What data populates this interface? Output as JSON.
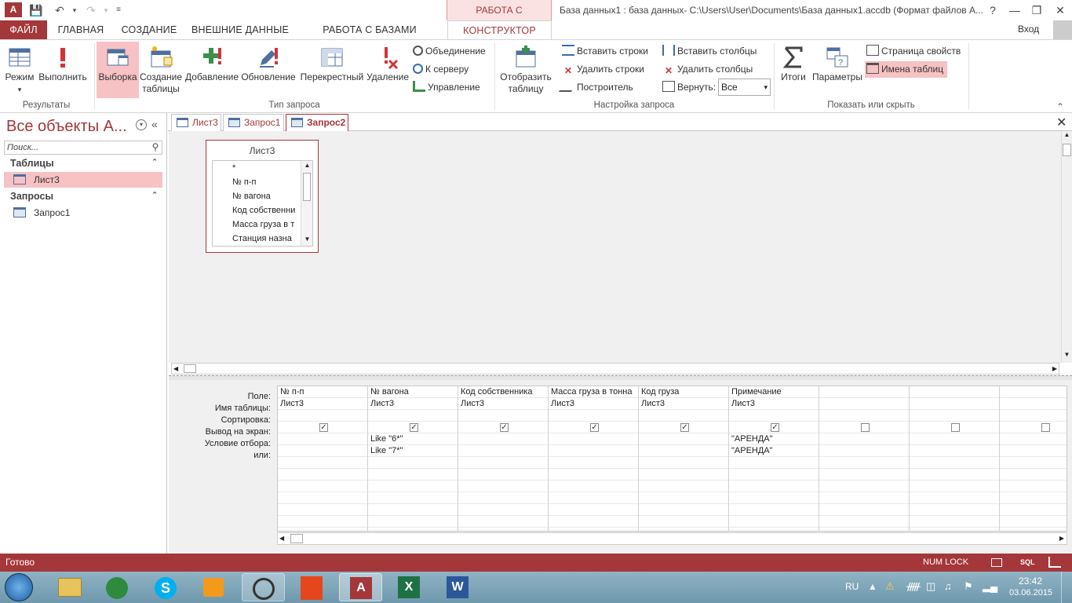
{
  "window": {
    "app_icon": "A",
    "contextual_group": "РАБОТА С ЗАПРОСАМИ",
    "title": "База данных1 : база данных- C:\\Users\\User\\Documents\\База данных1.accdb (Формат файлов A...",
    "help": "?",
    "login": "Вход"
  },
  "tabs": [
    "ФАЙЛ",
    "ГЛАВНАЯ",
    "СОЗДАНИЕ",
    "ВНЕШНИЕ ДАННЫЕ",
    "РАБОТА С БАЗАМИ ДАННЫХ",
    "КОНСТРУКТОР"
  ],
  "ribbon": {
    "results": {
      "mode": "Режим",
      "run": "Выполнить",
      "group": "Результаты"
    },
    "query_type": {
      "select": "Выборка",
      "make_table_1": "Создание",
      "make_table_2": "таблицы",
      "append": "Добавление",
      "update": "Обновление",
      "crosstab": "Перекрестный",
      "delete": "Удаление",
      "union": "Объединение",
      "passthrough": "К серверу",
      "ddl": "Управление",
      "group": "Тип запроса"
    },
    "setup": {
      "show_table_1": "Отобразить",
      "show_table_2": "таблицу",
      "insert_rows": "Вставить строки",
      "delete_rows": "Удалить строки",
      "builder": "Построитель",
      "insert_cols": "Вставить столбцы",
      "delete_cols": "Удалить столбцы",
      "return": "Вернуть:",
      "return_value": "Все",
      "group": "Настройка запроса"
    },
    "show_hide": {
      "totals": "Итоги",
      "params": "Параметры",
      "property_sheet": "Страница свойств",
      "table_names": "Имена таблиц",
      "group": "Показать или скрыть"
    }
  },
  "nav": {
    "title": "Все объекты А...",
    "search": "Поиск...",
    "tables_header": "Таблицы",
    "tables": [
      "Лист3"
    ],
    "queries_header": "Запросы",
    "queries": [
      "Запрос1"
    ]
  },
  "doc_tabs": [
    "Лист3",
    "Запрос1",
    "Запрос2"
  ],
  "table_box": {
    "title": "Лист3",
    "fields": [
      "*",
      "№ п-п",
      "№ вагона",
      "Код собственни",
      "Масса груза в т",
      "Станция назна"
    ]
  },
  "grid": {
    "row_labels": [
      "Поле:",
      "Имя таблицы:",
      "Сортировка:",
      "Вывод на экран:",
      "Условие отбора:",
      "или:"
    ],
    "columns": [
      {
        "field": "№ п-п",
        "table": "Лист3",
        "show": true,
        "criteria": "",
        "or": ""
      },
      {
        "field": "№ вагона",
        "table": "Лист3",
        "show": true,
        "criteria": "Like \"6*\"",
        "or": "Like \"7*\""
      },
      {
        "field": "Код собственника",
        "table": "Лист3",
        "show": true,
        "criteria": "",
        "or": ""
      },
      {
        "field": "Масса груза в тонна",
        "table": "Лист3",
        "show": true,
        "criteria": "",
        "or": ""
      },
      {
        "field": "Код груза",
        "table": "Лист3",
        "show": true,
        "criteria": "",
        "or": ""
      },
      {
        "field": "Примечание",
        "table": "Лист3",
        "show": true,
        "criteria": "\"АРЕНДА\"",
        "or": "\"АРЕНДА\""
      },
      {
        "field": "",
        "table": "",
        "show": false,
        "criteria": "",
        "or": ""
      },
      {
        "field": "",
        "table": "",
        "show": false,
        "criteria": "",
        "or": ""
      },
      {
        "field": "",
        "table": "",
        "show": false,
        "criteria": "",
        "or": ""
      }
    ]
  },
  "status": {
    "left": "Готово",
    "numlock": "NUM LOCK",
    "sql": "SQL"
  },
  "taskbar": {
    "lang": "RU",
    "time": "23:42",
    "date": "03.06.2015"
  },
  "colors": {
    "accent": "#a4373a",
    "selected": "#f7c2c4"
  }
}
